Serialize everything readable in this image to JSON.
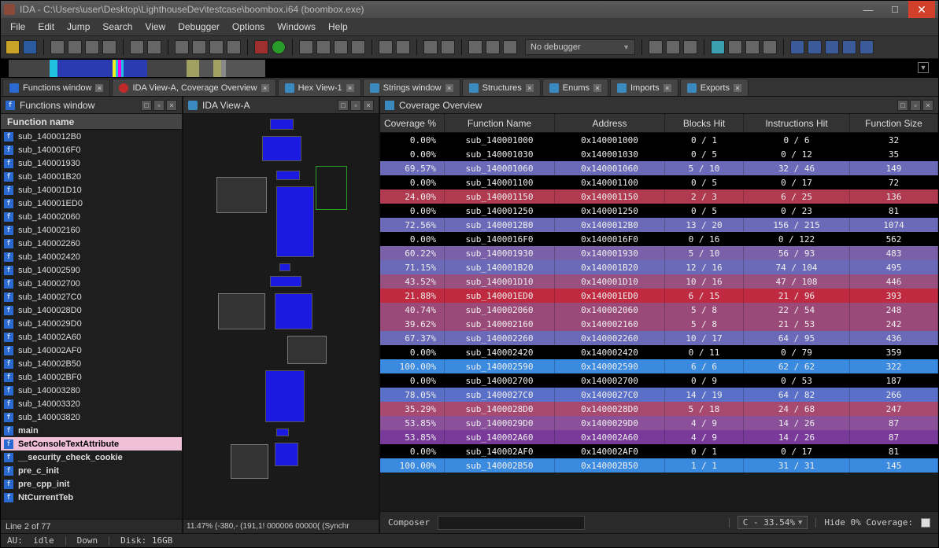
{
  "title": "IDA - C:\\Users\\user\\Desktop\\LighthouseDev\\testcase\\boombox.i64 (boombox.exe)",
  "menu": [
    "File",
    "Edit",
    "Jump",
    "Search",
    "View",
    "Debugger",
    "Options",
    "Windows",
    "Help"
  ],
  "debugger_combo": "No debugger",
  "tabs": [
    {
      "label": "Functions window",
      "icon": "f"
    },
    {
      "label": "IDA View-A, Coverage Overview",
      "icon": "dot",
      "notab": true
    },
    {
      "label": "Hex View-1",
      "icon": "generic"
    },
    {
      "label": "Strings window",
      "icon": "generic"
    },
    {
      "label": "Structures",
      "icon": "generic"
    },
    {
      "label": "Enums",
      "icon": "generic"
    },
    {
      "label": "Imports",
      "icon": "generic"
    },
    {
      "label": "Exports",
      "icon": "generic"
    }
  ],
  "functions_pane": {
    "title": "Functions window",
    "column": "Function name",
    "items": [
      {
        "name": "sub_1400012B0"
      },
      {
        "name": "sub_1400016F0"
      },
      {
        "name": "sub_140001930"
      },
      {
        "name": "sub_140001B20"
      },
      {
        "name": "sub_140001D10"
      },
      {
        "name": "sub_140001ED0"
      },
      {
        "name": "sub_140002060"
      },
      {
        "name": "sub_140002160"
      },
      {
        "name": "sub_140002260"
      },
      {
        "name": "sub_140002420"
      },
      {
        "name": "sub_140002590"
      },
      {
        "name": "sub_140002700"
      },
      {
        "name": "sub_1400027C0"
      },
      {
        "name": "sub_1400028D0"
      },
      {
        "name": "sub_1400029D0"
      },
      {
        "name": "sub_140002A60"
      },
      {
        "name": "sub_140002AF0"
      },
      {
        "name": "sub_140002B50"
      },
      {
        "name": "sub_140002BF0"
      },
      {
        "name": "sub_140003280"
      },
      {
        "name": "sub_140003320"
      },
      {
        "name": "sub_140003820"
      },
      {
        "name": "main",
        "bold": true
      },
      {
        "name": "SetConsoleTextAttribute",
        "hl": true,
        "bold": true
      },
      {
        "name": "__security_check_cookie",
        "bold": true
      },
      {
        "name": "pre_c_init",
        "bold": true
      },
      {
        "name": "pre_cpp_init",
        "bold": true
      },
      {
        "name": "NtCurrentTeb",
        "bold": true
      }
    ],
    "status": "Line 2 of 77"
  },
  "ida_view": {
    "title": "IDA View-A",
    "status": "11.47% (-380,-  (191,1! 000006  00000( (Synchr"
  },
  "coverage": {
    "title": "Coverage Overview",
    "columns": [
      "Coverage %",
      "Function Name",
      "Address",
      "Blocks Hit",
      "Instructions Hit",
      "Function Size"
    ],
    "rows": [
      {
        "pct": "0.00%",
        "fn": "sub_140001000",
        "addr": "0x140001000",
        "bl": "0 / 1",
        "ins": "0 / 6",
        "sz": "32",
        "color": "#000"
      },
      {
        "pct": "0.00%",
        "fn": "sub_140001030",
        "addr": "0x140001030",
        "bl": "0 / 5",
        "ins": "0 / 12",
        "sz": "35",
        "color": "#000"
      },
      {
        "pct": "69.57%",
        "fn": "sub_140001060",
        "addr": "0x140001060",
        "bl": "5 / 10",
        "ins": "32 / 46",
        "sz": "149",
        "color": "#6a6ab8"
      },
      {
        "pct": "0.00%",
        "fn": "sub_140001100",
        "addr": "0x140001100",
        "bl": "0 / 5",
        "ins": "0 / 17",
        "sz": "72",
        "color": "#000"
      },
      {
        "pct": "24.00%",
        "fn": "sub_140001150",
        "addr": "0x140001150",
        "bl": "2 / 3",
        "ins": "6 / 25",
        "sz": "136",
        "color": "#b03a50"
      },
      {
        "pct": "0.00%",
        "fn": "sub_140001250",
        "addr": "0x140001250",
        "bl": "0 / 5",
        "ins": "0 / 23",
        "sz": "81",
        "color": "#000"
      },
      {
        "pct": "72.56%",
        "fn": "sub_1400012B0",
        "addr": "0x1400012B0",
        "bl": "13 / 20",
        "ins": "156 / 215",
        "sz": "1074",
        "color": "#6a6ab8"
      },
      {
        "pct": "0.00%",
        "fn": "sub_1400016F0",
        "addr": "0x1400016F0",
        "bl": "0 / 16",
        "ins": "0 / 122",
        "sz": "562",
        "color": "#000"
      },
      {
        "pct": "60.22%",
        "fn": "sub_140001930",
        "addr": "0x140001930",
        "bl": "5 / 10",
        "ins": "56 / 93",
        "sz": "483",
        "color": "#7a60a8"
      },
      {
        "pct": "71.15%",
        "fn": "sub_140001B20",
        "addr": "0x140001B20",
        "bl": "12 / 16",
        "ins": "74 / 104",
        "sz": "495",
        "color": "#6a6ab8"
      },
      {
        "pct": "43.52%",
        "fn": "sub_140001D10",
        "addr": "0x140001D10",
        "bl": "10 / 16",
        "ins": "47 / 108",
        "sz": "446",
        "color": "#985080"
      },
      {
        "pct": "21.88%",
        "fn": "sub_140001ED0",
        "addr": "0x140001ED0",
        "bl": "6 / 15",
        "ins": "21 / 96",
        "sz": "393",
        "color": "#c02a40"
      },
      {
        "pct": "40.74%",
        "fn": "sub_140002060",
        "addr": "0x140002060",
        "bl": "5 / 8",
        "ins": "22 / 54",
        "sz": "248",
        "color": "#9a4a78"
      },
      {
        "pct": "39.62%",
        "fn": "sub_140002160",
        "addr": "0x140002160",
        "bl": "5 / 8",
        "ins": "21 / 53",
        "sz": "242",
        "color": "#9a4a78"
      },
      {
        "pct": "67.37%",
        "fn": "sub_140002260",
        "addr": "0x140002260",
        "bl": "10 / 17",
        "ins": "64 / 95",
        "sz": "436",
        "color": "#6a6ab8"
      },
      {
        "pct": "0.00%",
        "fn": "sub_140002420",
        "addr": "0x140002420",
        "bl": "0 / 11",
        "ins": "0 / 79",
        "sz": "359",
        "color": "#000"
      },
      {
        "pct": "100.00%",
        "fn": "sub_140002590",
        "addr": "0x140002590",
        "bl": "6 / 6",
        "ins": "62 / 62",
        "sz": "322",
        "color": "#3a8ae0"
      },
      {
        "pct": "0.00%",
        "fn": "sub_140002700",
        "addr": "0x140002700",
        "bl": "0 / 9",
        "ins": "0 / 53",
        "sz": "187",
        "color": "#000"
      },
      {
        "pct": "78.05%",
        "fn": "sub_1400027C0",
        "addr": "0x1400027C0",
        "bl": "14 / 19",
        "ins": "64 / 82",
        "sz": "266",
        "color": "#5a70c8"
      },
      {
        "pct": "35.29%",
        "fn": "sub_1400028D0",
        "addr": "0x1400028D0",
        "bl": "5 / 18",
        "ins": "24 / 68",
        "sz": "247",
        "color": "#a84a70"
      },
      {
        "pct": "53.85%",
        "fn": "sub_1400029D0",
        "addr": "0x1400029D0",
        "bl": "4 / 9",
        "ins": "14 / 26",
        "sz": "87",
        "color": "#8a509a"
      },
      {
        "pct": "53.85%",
        "fn": "sub_140002A60",
        "addr": "0x140002A60",
        "bl": "4 / 9",
        "ins": "14 / 26",
        "sz": "87",
        "color": "#7a3a9a"
      },
      {
        "pct": "0.00%",
        "fn": "sub_140002AF0",
        "addr": "0x140002AF0",
        "bl": "0 / 1",
        "ins": "0 / 17",
        "sz": "81",
        "color": "#000"
      },
      {
        "pct": "100.00%",
        "fn": "sub_140002B50",
        "addr": "0x140002B50",
        "bl": "1 / 1",
        "ins": "31 / 31",
        "sz": "145",
        "color": "#3a8ae0"
      }
    ]
  },
  "composer": {
    "label": "Composer",
    "value": "",
    "pct_label": "C - 33.54%",
    "hide_label": "Hide 0% Coverage:"
  },
  "bottom": {
    "au": "AU:",
    "idle": "idle",
    "down": "Down",
    "disk": "Disk: 16GB"
  }
}
